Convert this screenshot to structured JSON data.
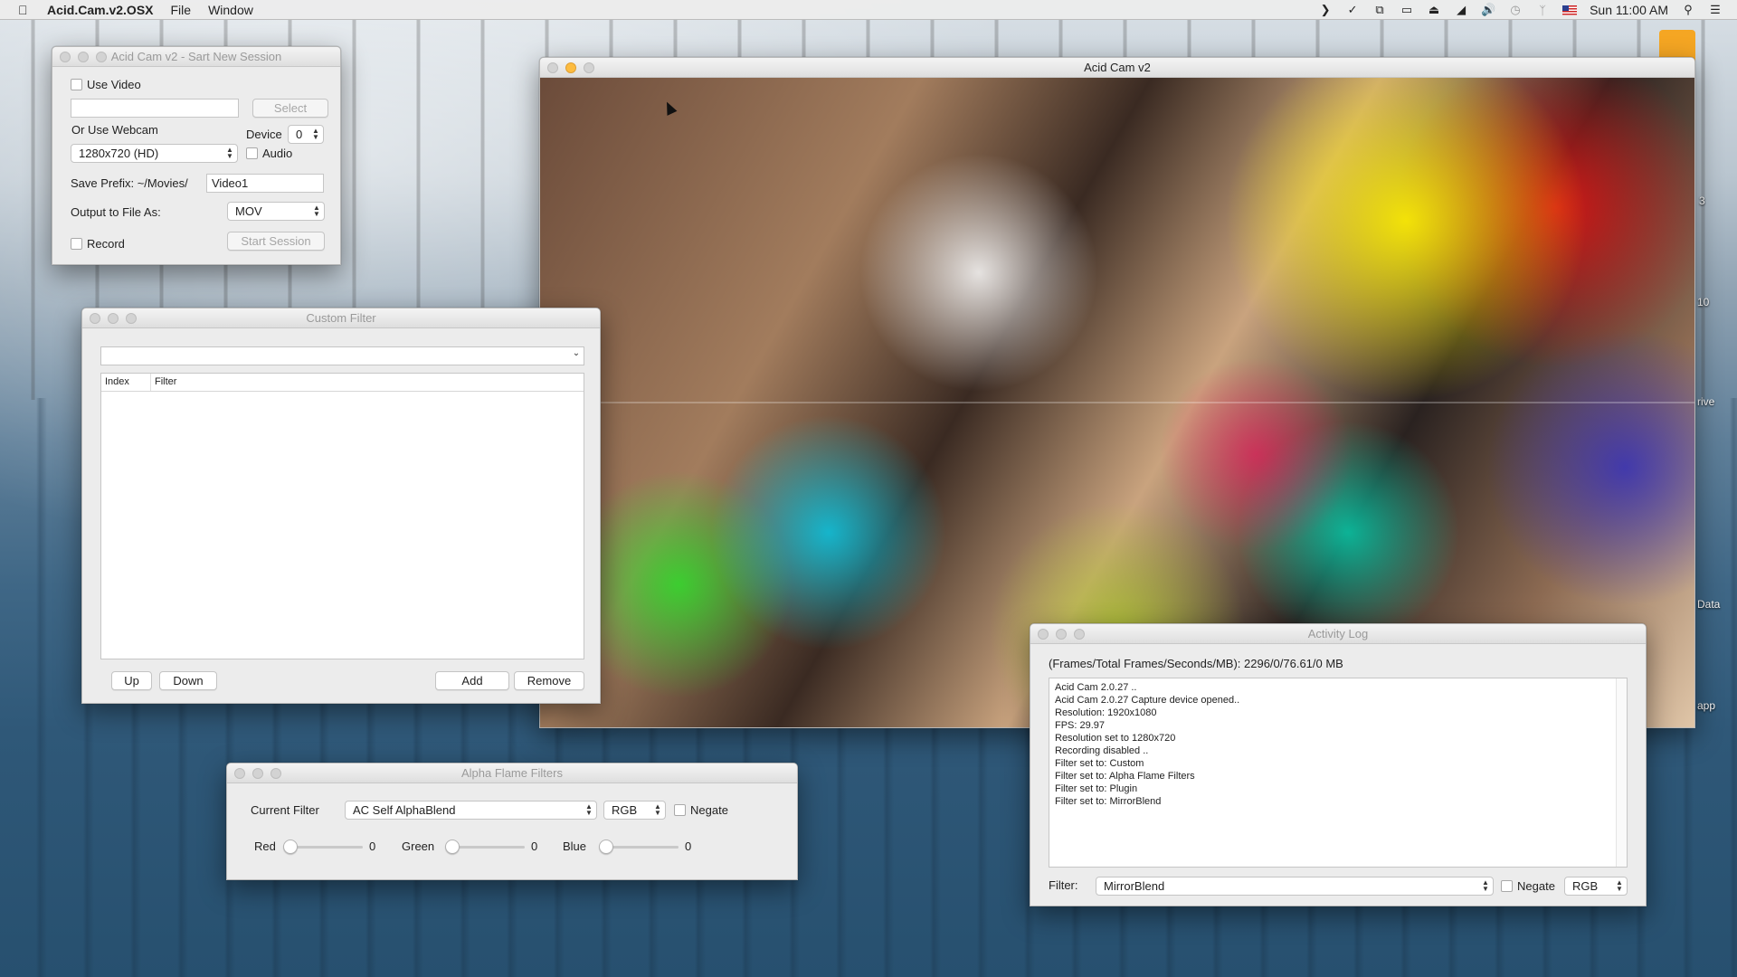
{
  "menubar": {
    "app_name": "Acid.Cam.v2.OSX",
    "menus": [
      "File",
      "Window"
    ],
    "clock": "Sun 11:00 AM",
    "status_icons": [
      "chevron-right-icon",
      "check-circle-icon",
      "windows-icon",
      "display-icon",
      "eject-icon",
      "wifi-icon",
      "volume-icon",
      "time-machine-icon",
      "bluetooth-icon",
      "flag-us-icon",
      "spotlight-icon",
      "notification-list-icon"
    ]
  },
  "desktop": {
    "labels": [
      "3",
      "10",
      "rive",
      "Data",
      "app"
    ]
  },
  "session": {
    "title": "Acid Cam v2 - Sart New Session",
    "use_video": "Use Video",
    "video_path": "",
    "select": "Select",
    "or_use_webcam": "Or Use Webcam",
    "device_label": "Device",
    "device_value": "0",
    "resolution": "1280x720 (HD)",
    "audio": "Audio",
    "save_prefix_label": "Save Prefix: ~/Movies/",
    "save_prefix_value": "Video1",
    "output_label": "Output to File As:",
    "output_value": "MOV",
    "record": "Record",
    "start_session": "Start Session"
  },
  "custom_filter": {
    "title": "Custom Filter",
    "selected": "",
    "columns": [
      "Index",
      "Filter"
    ],
    "up": "Up",
    "down": "Down",
    "add": "Add",
    "remove": "Remove"
  },
  "main_window": {
    "title": "Acid Cam v2"
  },
  "alpha_flame": {
    "title": "Alpha Flame Filters",
    "current_filter_label": "Current Filter",
    "current_filter": "AC Self AlphaBlend",
    "color_mode": "RGB",
    "negate": "Negate",
    "red_label": "Red",
    "red_value": "0",
    "green_label": "Green",
    "green_value": "0",
    "blue_label": "Blue",
    "blue_value": "0"
  },
  "activity_log": {
    "title": "Activity Log",
    "stats": "(Frames/Total Frames/Seconds/MB): 2296/0/76.61/0 MB",
    "lines": [
      "Acid Cam 2.0.27 ..",
      "Acid Cam 2.0.27 Capture device opened..",
      "Resolution: 1920x1080",
      "FPS: 29.97",
      "Resolution set to 1280x720",
      "Recording disabled ..",
      "Filter set to: Custom",
      "Filter set to: Alpha Flame Filters",
      "Filter set to: Plugin",
      "Filter set to: MirrorBlend"
    ],
    "filter_label": "Filter:",
    "filter_value": "MirrorBlend",
    "negate": "Negate",
    "color_mode": "RGB"
  }
}
